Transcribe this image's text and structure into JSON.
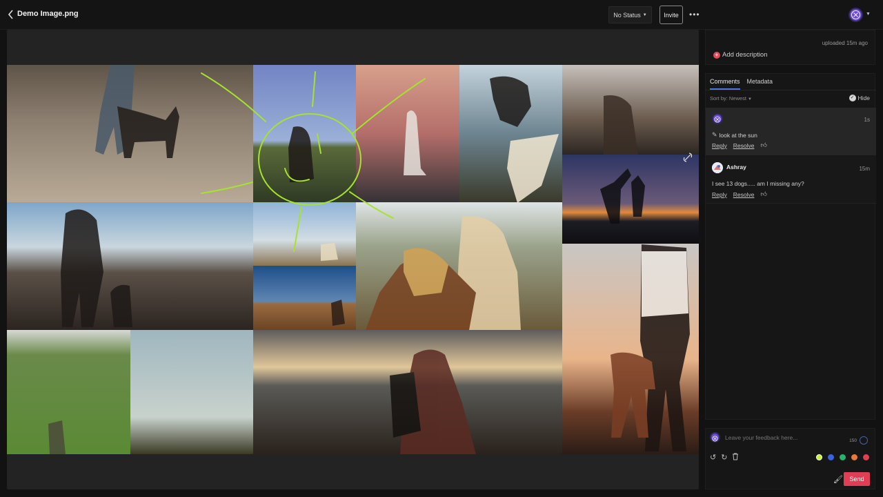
{
  "header": {
    "title": "Demo Image.png",
    "status_label": "No Status",
    "invite_label": "Invite",
    "more_label": "•••"
  },
  "upload": {
    "uploaded": "uploaded 15m ago",
    "add_description": "Add description"
  },
  "comments_panel": {
    "tabs": [
      "Comments",
      "Metadata"
    ],
    "sort_label": "Sort by: Newest",
    "hide_label": "Hide",
    "items": [
      {
        "author": "",
        "time": "1s",
        "body": "look at the sun",
        "reply": "Reply",
        "resolve": "Resolve",
        "avatar_color": "#6b48d6"
      },
      {
        "author": "Ashray",
        "time": "15m",
        "body": "I see 13 dogs..... am I missing any?",
        "reply": "Reply",
        "resolve": "Resolve",
        "avatar_color": "#e57373"
      }
    ]
  },
  "feedback": {
    "placeholder": "Leave your feedback here...",
    "char_count": "150",
    "send_label": "Send",
    "colors": [
      "#c6f235",
      "#3b63e0",
      "#25b36d",
      "#e57a3a",
      "#e03e55"
    ]
  },
  "annotation": {
    "stroke_color": "#a6e22e"
  },
  "photos": [
    {
      "name": "photo-person-dog-beach",
      "color1": "#6d6256",
      "color2": "#b9ab98"
    },
    {
      "name": "photo-dog-hill-sun",
      "color1": "#6e7fb8",
      "color2": "#3c4a2a"
    },
    {
      "name": "photo-woman-dress-sunset",
      "color1": "#c88a7a",
      "color2": "#3d3a3a"
    },
    {
      "name": "photo-dog-snack",
      "color1": "#8aa6b8",
      "color2": "#d9b98a"
    },
    {
      "name": "photo-woman-rocks",
      "color1": "#b8a899",
      "color2": "#3a3430"
    },
    {
      "name": "photo-silhouette-dog-dusk",
      "color1": "#3c3f6e",
      "color2": "#d27a3a"
    },
    {
      "name": "photo-hiker-backpack-mountains",
      "color1": "#a7b8c9",
      "color2": "#3a3028"
    },
    {
      "name": "photo-dog-field-clouds",
      "color1": "#8fb0d1",
      "color2": "#8a7a5a"
    },
    {
      "name": "photo-hikers-desert",
      "color1": "#2f5a8c",
      "color2": "#8a5a34"
    },
    {
      "name": "photo-woman-dog-beanie",
      "color1": "#b7c1b8",
      "color2": "#b06b2a"
    },
    {
      "name": "photo-man-dog-sunset",
      "color1": "#d3b9a0",
      "color2": "#4a3228"
    },
    {
      "name": "photo-green-valley-hikers",
      "color1": "#7a9a58",
      "color2": "#3e5a2a"
    },
    {
      "name": "photo-sky-tree-hiker",
      "color1": "#a9bbc1",
      "color2": "#2e3a26"
    },
    {
      "name": "photo-woman-dog-overlook",
      "color1": "#7a7064",
      "color2": "#3a2a22"
    }
  ]
}
